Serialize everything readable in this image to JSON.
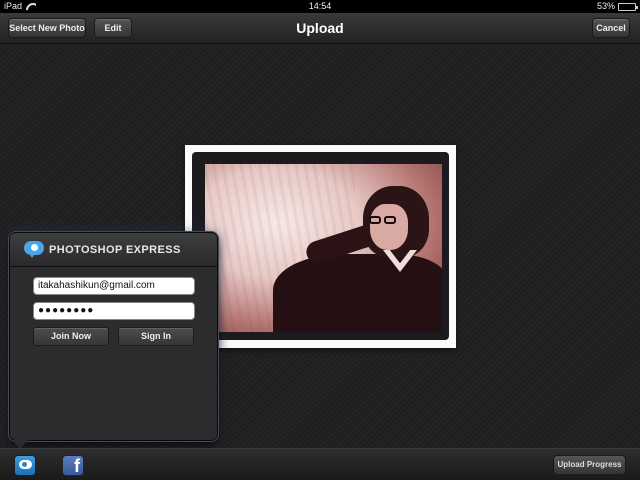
{
  "status_bar": {
    "device": "iPad",
    "time": "14:54",
    "battery_text": "53%",
    "battery_level": 0.53
  },
  "toolbar": {
    "select_new_photo_label": "Select New Photo",
    "edit_label": "Edit",
    "title": "Upload",
    "cancel_label": "Cancel"
  },
  "login_popover": {
    "brand": "PHOTOSHOP EXPRESS",
    "email_value": "itakahashikun@gmail.com",
    "password_value": "●●●●●●●●",
    "join_label": "Join Now",
    "signin_label": "Sign In"
  },
  "bottom_bar": {
    "services": [
      {
        "icon": "photoshop-express-icon"
      },
      {
        "icon": "facebook-icon",
        "glyph": "f"
      }
    ],
    "upload_progress_label": "Upload Progress"
  },
  "colors": {
    "photoshop_blue": "#4aa6e8",
    "facebook_blue": "#3b5998"
  }
}
